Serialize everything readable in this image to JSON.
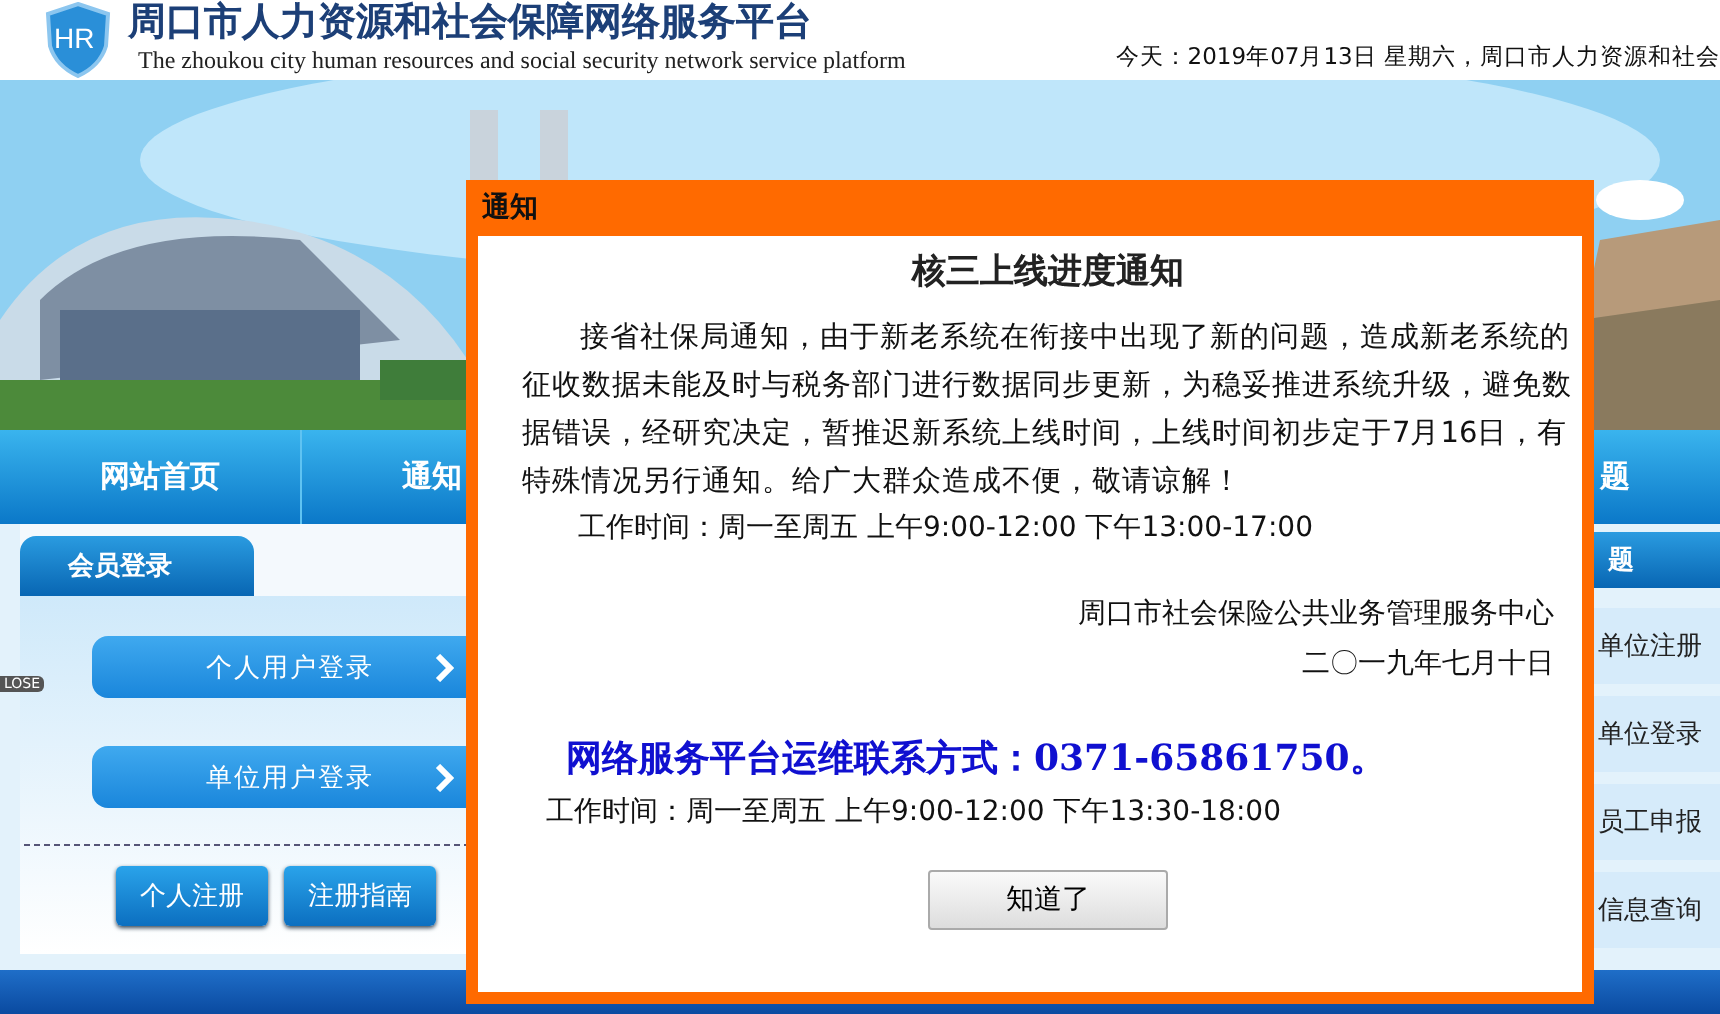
{
  "header": {
    "logo": "HR",
    "title": "周口市人力资源和社会保障网络服务平台",
    "subtitle": "The zhoukou city human resources and social security network service platform",
    "date_line": "今天：2019年07月13日 星期六，周口市人力资源和社会"
  },
  "nav": {
    "items": [
      "网站首页",
      "通知"
    ],
    "right_item": "题"
  },
  "close_tag": "LOSE",
  "login_panel": {
    "tab": "会员登录",
    "login_buttons": [
      "个人用户登录",
      "单位用户登录"
    ],
    "buttons": [
      "个人注册",
      "注册指南"
    ]
  },
  "side_panel": {
    "tab": "题",
    "items": [
      "单位注册",
      "单位登录",
      "员工申报",
      "信息查询"
    ]
  },
  "dialog": {
    "title": "通知",
    "heading": "核三上线进度通知",
    "paragraph": "接省社保局通知，由于新老系统在衔接中出现了新的问题，造成新老系统的征收数据未能及时与税务部门进行数据同步更新，为稳妥推进系统升级，避免数据错误，经研究决定，暂推迟新系统上线时间，上线时间初步定于7月16日，有特殊情况另行通知。给广大群众造成不便，敬请谅解！",
    "work_hours": "工作时间：周一至周五 上午9:00-12:00 下午13:00-17:00",
    "signature": [
      "周口市社会保险公共业务管理服务中心",
      "二〇一九年七月十日"
    ],
    "contact": "网络服务平台运维联系方式：0371-65861750。",
    "contact_hours": "工作时间：周一至周五 上午9:00-12:00 下午13:30-18:00",
    "ok_button": "知道了"
  }
}
